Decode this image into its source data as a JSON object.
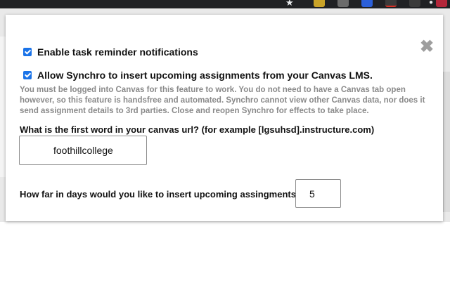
{
  "settings": {
    "enable_reminders_label": "Enable task reminder notifications",
    "enable_reminders_checked": true,
    "allow_canvas_label": "Allow Synchro to insert upcoming assignments from your Canvas LMS.",
    "allow_canvas_checked": true,
    "canvas_help_text": "You must be logged into Canvas for this feature to work. You do not need to have a Canvas tab open however, so this feature is handsfree and automated. Synchro cannot view other Canvas data, nor does it send assignment details to 3rd parties. Close and reopen Synchro for effects to take place.",
    "canvas_url_question": "What is the first word in your canvas url? (for example [lgsuhsd].instructure.com)",
    "canvas_url_value": "foothillcollege",
    "days_question": "How far in days would you like to insert upcoming assingments?",
    "days_value": "5"
  },
  "colors": {
    "checkbox_accent": "#1a73e8",
    "help_text": "#8a8a8a",
    "close_icon": "#9e9e9e"
  }
}
